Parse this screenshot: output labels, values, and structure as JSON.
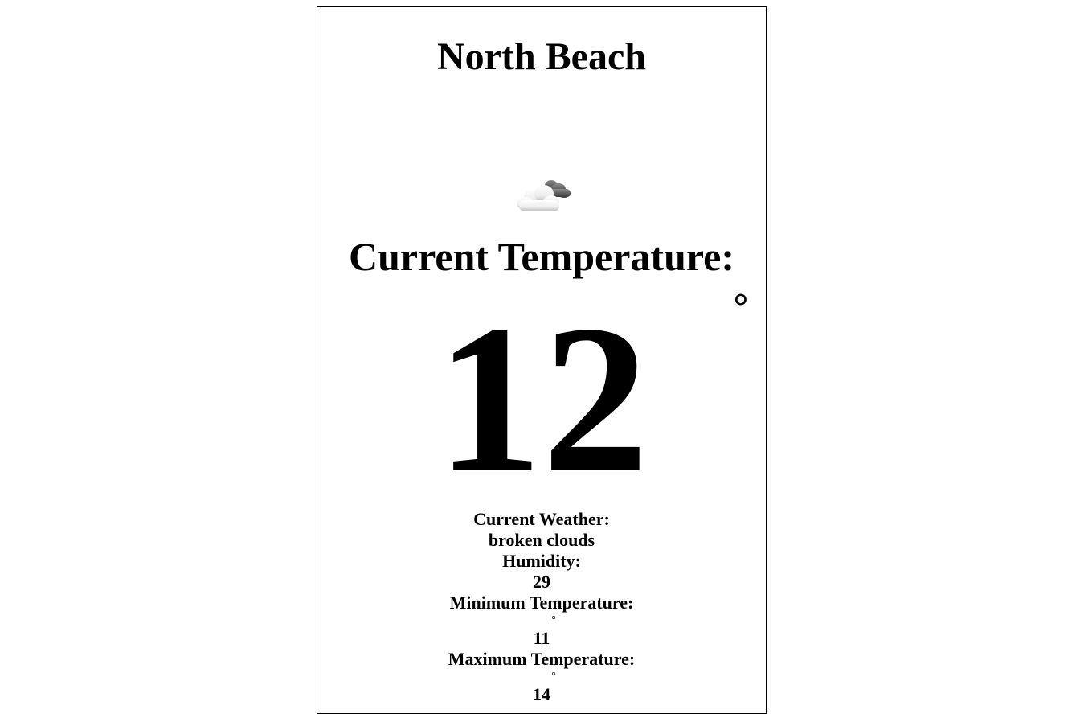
{
  "location": {
    "city": "North Beach"
  },
  "weather_icon": {
    "name": "broken-clouds-icon"
  },
  "current": {
    "label": "Current Temperature:",
    "value": "12",
    "degree_symbol": "°"
  },
  "details": {
    "weather_label": "Current Weather:",
    "weather_value": "broken clouds",
    "humidity_label": "Humidity:",
    "humidity_value": "29",
    "min_label": "Minimum Temperature:",
    "min_degree": "°",
    "min_value": "11",
    "max_label": "Maximum Temperature:",
    "max_degree": "°",
    "max_value": "14"
  },
  "colors": {
    "text": "#000000",
    "background": "#ffffff",
    "border": "#000000"
  }
}
